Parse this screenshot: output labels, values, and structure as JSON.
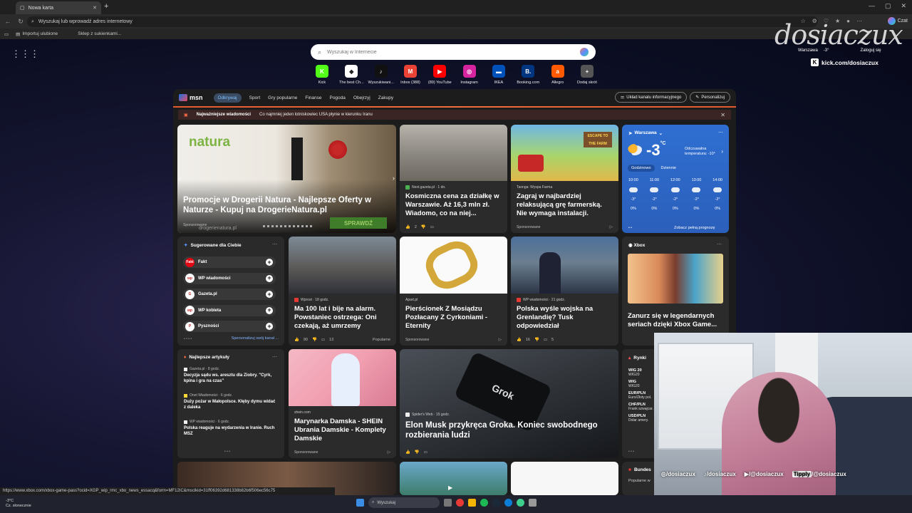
{
  "browser": {
    "tab_title": "Nowa karta",
    "url_placeholder": "Wyszukaj lub wprowadź adres internetowy",
    "copilot_label": "Czat",
    "favorites": [
      "Importuj ulubione",
      "Sklep z sukienkami..."
    ],
    "status_url": "https://www.xbox.com/xbox-game-pass?ocid=XGP_wip_rmc_xbo_news_essacq&form=MF12IC&msclkid=31ff06392d681338b82b6f506ec56c75"
  },
  "newtab": {
    "search_placeholder": "Wyszukaj w Internecie",
    "quick_links": [
      {
        "label": "Kick",
        "color": "#53fc18",
        "glyph": "K"
      },
      {
        "label": "The best Ch...",
        "color": "#ffffff",
        "glyph": "◆"
      },
      {
        "label": "Wyszukiwani...",
        "color": "#111111",
        "glyph": "♪"
      },
      {
        "label": "Inbox (388)",
        "color": "#ea4335",
        "glyph": "M"
      },
      {
        "label": "(89) YouTube",
        "color": "#ff0000",
        "glyph": "▶"
      },
      {
        "label": "Instagram",
        "color": "#d6249f",
        "glyph": "◎"
      },
      {
        "label": "IKEA",
        "color": "#0051ba",
        "glyph": "▬"
      },
      {
        "label": "Booking.com",
        "color": "#003580",
        "glyph": "B."
      },
      {
        "label": "Allegro",
        "color": "#ff5a00",
        "glyph": "a"
      },
      {
        "label": "Dodaj skrót",
        "color": "#555555",
        "glyph": "+"
      }
    ],
    "header_weather": {
      "city": "Warszawa",
      "temp": "-3°",
      "signin": "Zaloguj się"
    }
  },
  "streamer": {
    "logo": "dosiaczux",
    "kick_url": "kick.com/dosiaczux",
    "socials": [
      "/dosiaczux",
      "/dosiaczux",
      "/@dosiaczux",
      "Tipply",
      "/@dosiaczux"
    ]
  },
  "msn": {
    "brand": "msn",
    "nav": [
      "Odkrywaj",
      "Sport",
      "Gry popularne",
      "Finanse",
      "Pogoda",
      "Obejrzyj",
      "Zakupy"
    ],
    "layout_btn": "Układ kanału informacyjnego",
    "personalize_btn": "Personalizuj",
    "breaking_label": "Najważniejsze wiadomości",
    "breaking_text": "Co najmniej jeden lotniskowiec USA płynie w kierunku Iranu",
    "hero": {
      "brand_text": "natura",
      "source": "drogerienatura.pl",
      "title": "Promocje w Drogerii Natura - Najlepsze Oferty w Naturze - Kupuj na DrogerieNatura.pl",
      "sponsor": "Sponsorowane",
      "domain": "drogerienatura.pl",
      "cta": "SPRAWDŹ"
    },
    "card_land": {
      "source": "Next.gazeta.pl · 1 dn.",
      "title": "Kosmiczna cena za działkę w Warszawie. Aż 16,3 mln zł. Wiadomo, co na niej...",
      "likes": "2"
    },
    "card_farm": {
      "source": "Taonga: Wyspa Farma",
      "title": "Zagraj w najbardziej relaksującą grę farmerską. Nie wymaga instalacji.",
      "sponsor": "Sponsorowane",
      "badge": "ESCAPE TO THE FARM"
    },
    "weather": {
      "city": "Warszawa",
      "temp": "-3",
      "unit": "°C",
      "feels": "Odczuwalna temperatura: -10°",
      "tabs": [
        "Godzinowo",
        "Dziennie"
      ],
      "hours": [
        {
          "t": "10:00",
          "v": "-3°",
          "p": "0%"
        },
        {
          "t": "11:00",
          "v": "-2°",
          "p": "0%"
        },
        {
          "t": "12:00",
          "v": "-2°",
          "p": "0%"
        },
        {
          "t": "13:00",
          "v": "-2°",
          "p": "0%"
        },
        {
          "t": "14:00",
          "v": "-2°",
          "p": "0%"
        }
      ],
      "footer": "Zobacz pełną prognozę"
    },
    "suggested": {
      "title": "Sugerowane dla Ciebie",
      "items": [
        {
          "name": "Fakt",
          "color": "#e30613",
          "glyph": "Fakt"
        },
        {
          "name": "WP wiadomości",
          "color": "#ffffff",
          "glyph": "wp"
        },
        {
          "name": "Gazeta.pl",
          "color": "#ffffff",
          "glyph": "G"
        },
        {
          "name": "WP kobieta",
          "color": "#ffffff",
          "glyph": "wp"
        },
        {
          "name": "Pyszności",
          "color": "#ffffff",
          "glyph": "P"
        }
      ],
      "footer": "Spersonalizuj swój kanał ..."
    },
    "card_protest": {
      "source": "Wprost · 18 godz.",
      "title": "Ma 100 lat i bije na alarm. Powstaniec ostrzega: Oni czekają, aż umrzemy",
      "likes": "90",
      "comments": "13",
      "tag": "Popularne"
    },
    "card_ring": {
      "source": "Apart.pl",
      "title": "Pierścionek Z Mosiądzu Pozłacany Z Cyrkoniami - Eternity",
      "sponsor": "Sponsorowane"
    },
    "card_tusk": {
      "source": "WP wiadomości · 21 godz.",
      "title": "Polska wyśle wojska na Grenlandię? Tusk odpowiedział",
      "likes": "16",
      "comments": "5"
    },
    "card_xbox": {
      "label": "Xbox",
      "title": "Zanurz się w legendarnych seriach dzięki Xbox Game..."
    },
    "top_articles": {
      "title": "Najlepsze artykuły",
      "items": [
        {
          "source": "Gazeta.pl · 8 godz.",
          "title": "Decyzja sądu ws. aresztu dla Ziobry. \"Cyrk, kpina i gra na czas\""
        },
        {
          "source": "Onet Wiadomości · 6 godz.",
          "title": "Duży pożar w Małopolsce. Kłęby dymu widać z daleka"
        },
        {
          "source": "WP wiadomości · 6 godz.",
          "title": "Polska reaguje na wydarzenia w Iranie. Ruch MSZ"
        }
      ]
    },
    "card_shein": {
      "source": "shein.com",
      "title": "Marynarka Damska - SHEIN Ubrania Damskie - Komplety Damskie",
      "sponsor": "Sponsorowane"
    },
    "card_grok": {
      "source": "Spider's Web · 15 godz.",
      "title": "Elon Musk przykręca Groka. Koniec swobodnego rozbierania ludzi",
      "phone_text": "Grok"
    },
    "markets": {
      "title": "Rynki",
      "rows": [
        {
          "k": "WIG 20",
          "s": "WIG20"
        },
        {
          "k": "WIG",
          "s": "WIG20"
        },
        {
          "k": "EUR/PLN",
          "s": "Euro/Złoty pol."
        },
        {
          "k": "CHF/PLN",
          "s": "Frank szwajcar."
        },
        {
          "k": "USD/PLN",
          "s": "Dolar amery."
        }
      ]
    },
    "bundes": {
      "title": "Bundes",
      "sub": "Popularne w"
    }
  },
  "taskbar": {
    "temp": "-3°C",
    "cond": "Cz. słonecznie",
    "search": "Wyszukaj"
  }
}
